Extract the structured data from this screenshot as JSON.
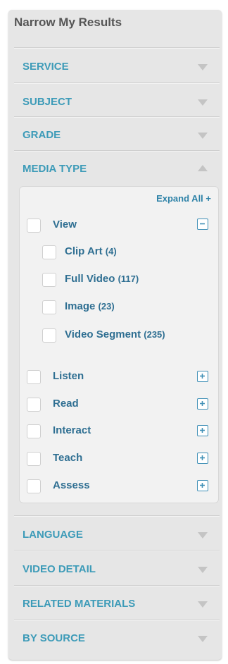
{
  "panel": {
    "title": "Narrow My Results"
  },
  "sections_top": [
    {
      "label": "SERVICE",
      "state": "collapsed"
    },
    {
      "label": "SUBJECT",
      "state": "collapsed"
    },
    {
      "label": "GRADE",
      "state": "collapsed"
    },
    {
      "label": "MEDIA TYPE",
      "state": "expanded"
    }
  ],
  "media_type": {
    "expand_all_label": "Expand All +",
    "view": {
      "label": "View",
      "toggle": "minus",
      "children": [
        {
          "label": "Clip Art",
          "count": "(4)"
        },
        {
          "label": "Full Video",
          "count": "(117)"
        },
        {
          "label": "Image",
          "count": "(23)"
        },
        {
          "label": "Video Segment",
          "count": "(235)"
        }
      ]
    },
    "others": [
      {
        "label": "Listen",
        "toggle": "plus"
      },
      {
        "label": "Read",
        "toggle": "plus"
      },
      {
        "label": "Interact",
        "toggle": "plus"
      },
      {
        "label": "Teach",
        "toggle": "plus"
      },
      {
        "label": "Assess",
        "toggle": "plus"
      }
    ]
  },
  "sections_bottom": [
    {
      "label": "LANGUAGE",
      "state": "collapsed"
    },
    {
      "label": "VIDEO DETAIL",
      "state": "collapsed"
    },
    {
      "label": "RELATED MATERIALS",
      "state": "collapsed"
    },
    {
      "label": "BY SOURCE",
      "state": "collapsed"
    }
  ],
  "colors": {
    "panel_bg": "#e6e6e6",
    "section_label": "#3d9bb8",
    "item_label": "#2f6f92",
    "toggle_border": "#3f8fb6",
    "triangle": "#c4c4c4"
  },
  "icons": {
    "collapsed": "triangle-down-icon",
    "expanded": "triangle-up-icon",
    "toggle_plus": "plus-square-icon",
    "toggle_minus": "minus-square-icon"
  }
}
